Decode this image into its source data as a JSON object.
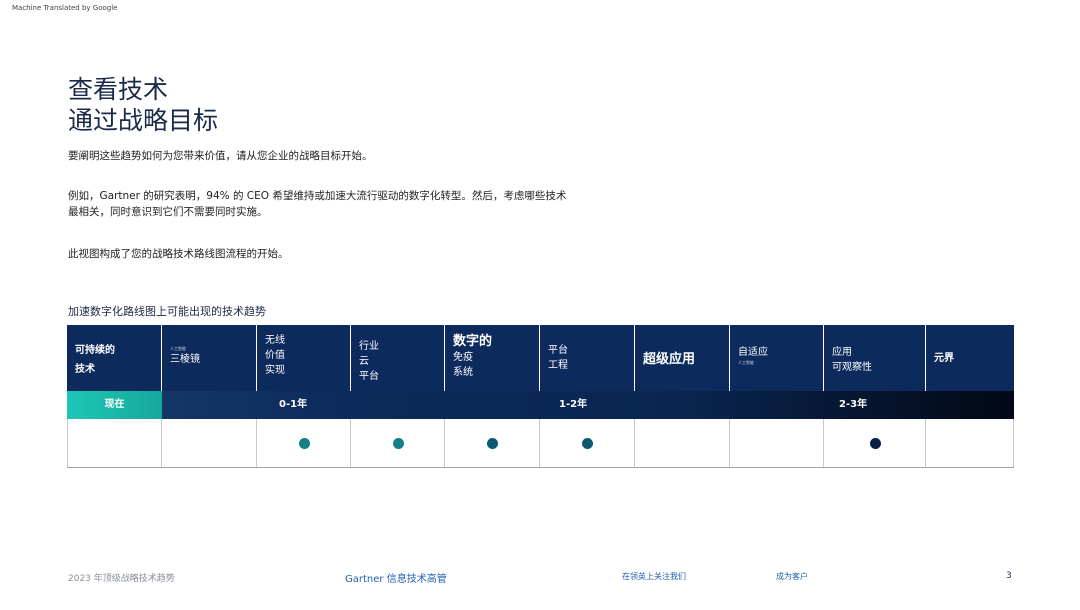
{
  "machine_translated": "Machine Translated by Google",
  "title": {
    "line1": "查看技术",
    "line2": "通过战略目标"
  },
  "paragraphs": {
    "p1": "要阐明这些趋势如何为您带来价值，请从您企业的战略目标开始。",
    "p2": "例如，Gartner 的研究表明，94% 的 CEO 希望维持或加速大流行驱动的数字化转型。然后，考虑哪些技术最相关，同时意识到它们不需要同时实施。",
    "p3": "此视图构成了您的战略技术路线图流程的开始。"
  },
  "table_caption": "加速数字化路线图上可能出现的技术趋势",
  "columns": [
    {
      "lines": [
        "可持续的",
        "技术"
      ],
      "small": ""
    },
    {
      "lines": [
        "三棱镜"
      ],
      "small": "人工智能"
    },
    {
      "lines": [
        "无线",
        "价值",
        "实现"
      ],
      "small": ""
    },
    {
      "lines": [
        "行业",
        "云",
        "平台"
      ],
      "small": ""
    },
    {
      "lines": [
        "数字的",
        "免疫",
        "系统"
      ],
      "small": ""
    },
    {
      "lines": [
        "平台",
        "工程"
      ],
      "small": ""
    },
    {
      "lines": [
        "超级应用"
      ],
      "small": ""
    },
    {
      "lines": [
        "自适应"
      ],
      "small": "人工智能"
    },
    {
      "lines": [
        "应用",
        "可观察性"
      ],
      "small": ""
    },
    {
      "lines": [
        "元界"
      ],
      "small": ""
    }
  ],
  "timeline": {
    "now": "现在",
    "t1": "0-1年",
    "t2": "1-2年",
    "t3": "2-3年"
  },
  "dots": [
    {
      "col": 2,
      "color": "#137f86"
    },
    {
      "col": 3,
      "color": "#137f86"
    },
    {
      "col": 4,
      "color": "#0f5a70"
    },
    {
      "col": 5,
      "color": "#0f5a70"
    },
    {
      "col": 8,
      "color": "#0a1f45"
    }
  ],
  "footer": {
    "left": "2023 年顶级战略技术趋势",
    "center": "Gartner 信息技术高管",
    "link1": "在领英上关注我们",
    "link2": "成为客户",
    "page": "3"
  }
}
